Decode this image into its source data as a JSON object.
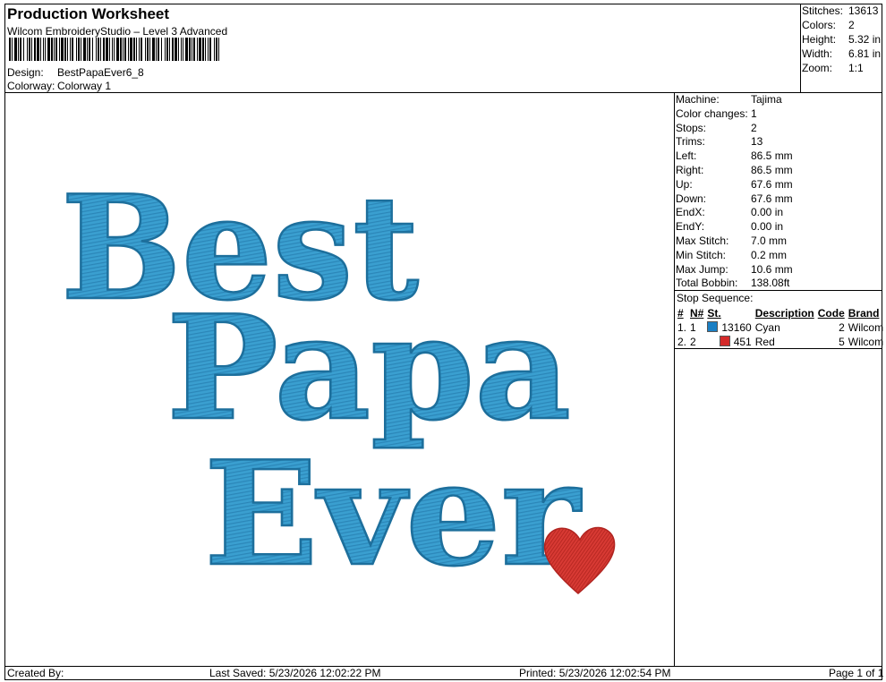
{
  "header": {
    "title": "Production Worksheet",
    "subtitle": "Wilcom EmbroideryStudio – Level 3 Advanced",
    "design_label": "Design:",
    "design_value": "BestPapaEver6_8",
    "colorway_label": "Colorway:",
    "colorway_value": "Colorway 1"
  },
  "stats": [
    {
      "label": "Stitches:",
      "value": "13613"
    },
    {
      "label": "Colors:",
      "value": "2"
    },
    {
      "label": "Height:",
      "value": "5.32 in"
    },
    {
      "label": "Width:",
      "value": "6.81 in"
    },
    {
      "label": "Zoom:",
      "value": "1:1"
    }
  ],
  "machine_info": [
    {
      "label": "Machine:",
      "value": "Tajima"
    },
    {
      "label": "Color changes:",
      "value": "1"
    },
    {
      "label": "Stops:",
      "value": "2"
    },
    {
      "label": "Trims:",
      "value": "13"
    },
    {
      "label": "Left:",
      "value": "86.5 mm"
    },
    {
      "label": "Right:",
      "value": "86.5 mm"
    },
    {
      "label": "Up:",
      "value": "67.6 mm"
    },
    {
      "label": "Down:",
      "value": "67.6 mm"
    },
    {
      "label": "EndX:",
      "value": "0.00 in"
    },
    {
      "label": "EndY:",
      "value": "0.00 in"
    },
    {
      "label": "Max Stitch:",
      "value": "7.0 mm"
    },
    {
      "label": "Min Stitch:",
      "value": "0.2 mm"
    },
    {
      "label": "Max Jump:",
      "value": "10.6 mm"
    },
    {
      "label": "Total Bobbin:",
      "value": "138.08ft"
    }
  ],
  "stop_sequence": {
    "title": "Stop Sequence:",
    "headers": [
      "#",
      "N#",
      "St.",
      "Description",
      "Code",
      "Brand"
    ],
    "rows": [
      {
        "idx": "1.",
        "n": "1",
        "color": "#1a7fc4",
        "st": "13160",
        "desc": "Cyan",
        "code": "2",
        "brand": "Wilcom"
      },
      {
        "idx": "2.",
        "n": "2",
        "color": "#d42a2a",
        "st": "451",
        "desc": "Red",
        "code": "5",
        "brand": "Wilcom"
      }
    ]
  },
  "design_preview": {
    "lines": [
      "Best",
      "Papa",
      "Ever"
    ],
    "thread_color": "#3a9fd0",
    "thread_shadow": "#1d6f9c",
    "heart_color": "#d83a34"
  },
  "footer": {
    "created_by": "Created By:",
    "last_saved": "Last Saved: 5/23/2026 12:02:22 PM",
    "printed": "Printed: 5/23/2026 12:02:54 PM",
    "page": "Page 1 of 1"
  }
}
